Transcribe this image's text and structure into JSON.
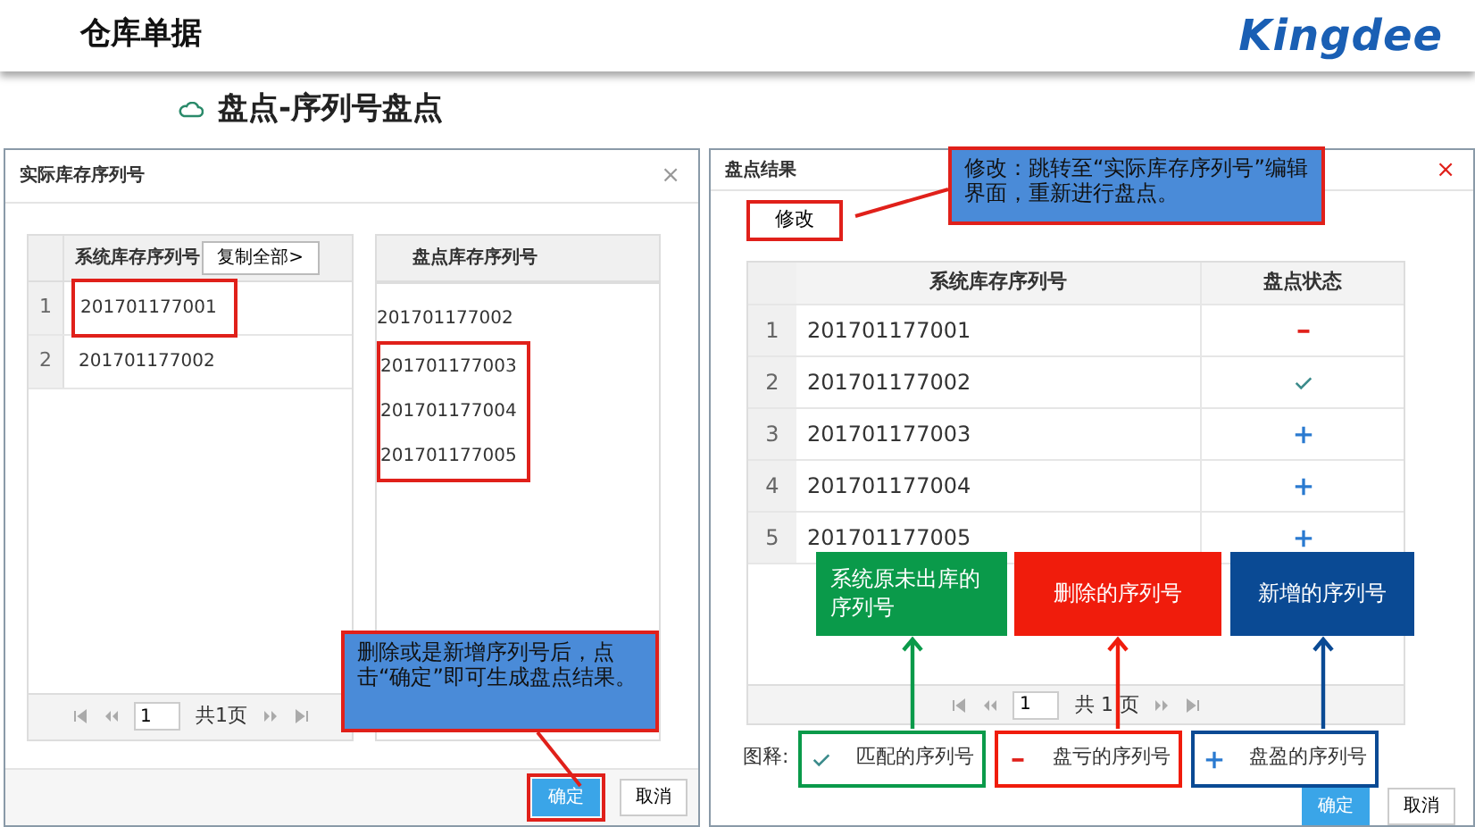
{
  "header": {
    "title": "仓库单据",
    "logo": "Kingdee"
  },
  "subtitle": "盘点-序列号盘点",
  "left_dialog": {
    "title": "实际库存序列号",
    "close": "×",
    "system_panel": {
      "column": "系统库存序列号",
      "copy_button": "复制全部>",
      "rows": [
        {
          "index": "1",
          "serial": "201701177001",
          "highlighted": true
        },
        {
          "index": "2",
          "serial": "201701177002",
          "highlighted": false
        }
      ],
      "pager": {
        "page": "1",
        "total": "共1页"
      }
    },
    "count_panel": {
      "column": "盘点库存序列号",
      "lines": [
        {
          "serial": "201701177002",
          "highlighted": false
        },
        {
          "serial": "201701177003",
          "highlighted": true
        },
        {
          "serial": "201701177004",
          "highlighted": true
        },
        {
          "serial": "201701177005",
          "highlighted": true
        }
      ]
    },
    "buttons": [
      {
        "label": "确定",
        "kind": "primary",
        "highlighted": true
      },
      {
        "label": "取消",
        "kind": "secondary",
        "highlighted": false
      }
    ],
    "callout": "删除或是新增序列号后，点击“确定”即可生成盘点结果。"
  },
  "right_dialog": {
    "title": "盘点结果",
    "close": "×",
    "edit_button": {
      "label": "修改",
      "highlighted": true
    },
    "callout": "修改：跳转至“实际库存序列号”编辑界面，重新进行盘点。",
    "table": {
      "columns": [
        "系统库存序列号",
        "盘点状态"
      ],
      "rows": [
        {
          "index": "1",
          "serial": "201701177001",
          "kind": "loss"
        },
        {
          "index": "2",
          "serial": "201701177002",
          "kind": "match"
        },
        {
          "index": "3",
          "serial": "201701177003",
          "kind": "gain"
        },
        {
          "index": "4",
          "serial": "201701177004",
          "kind": "gain"
        },
        {
          "index": "5",
          "serial": "201701177005",
          "kind": "gain"
        }
      ],
      "pager": {
        "page": "1",
        "total": "共 1 页"
      }
    },
    "annotations": [
      {
        "text": "系统原未出库的序列号",
        "color": "#0a9a4a"
      },
      {
        "text": "删除的序列号",
        "color": "#f01c0c"
      },
      {
        "text": "新增的序列号",
        "color": "#0a4a94"
      }
    ],
    "legend": {
      "label": "图释:",
      "items": [
        {
          "kind": "match",
          "text": "匹配的序列号",
          "color": "#0a9a4a"
        },
        {
          "kind": "loss",
          "text": "盘亏的序列号",
          "color": "#f01c0c"
        },
        {
          "kind": "gain",
          "text": "盘盈的序列号",
          "color": "#0a4a94"
        }
      ]
    },
    "buttons": [
      {
        "label": "确定",
        "kind": "primary",
        "highlighted": false
      },
      {
        "label": "取消",
        "kind": "secondary",
        "highlighted": false
      }
    ]
  }
}
